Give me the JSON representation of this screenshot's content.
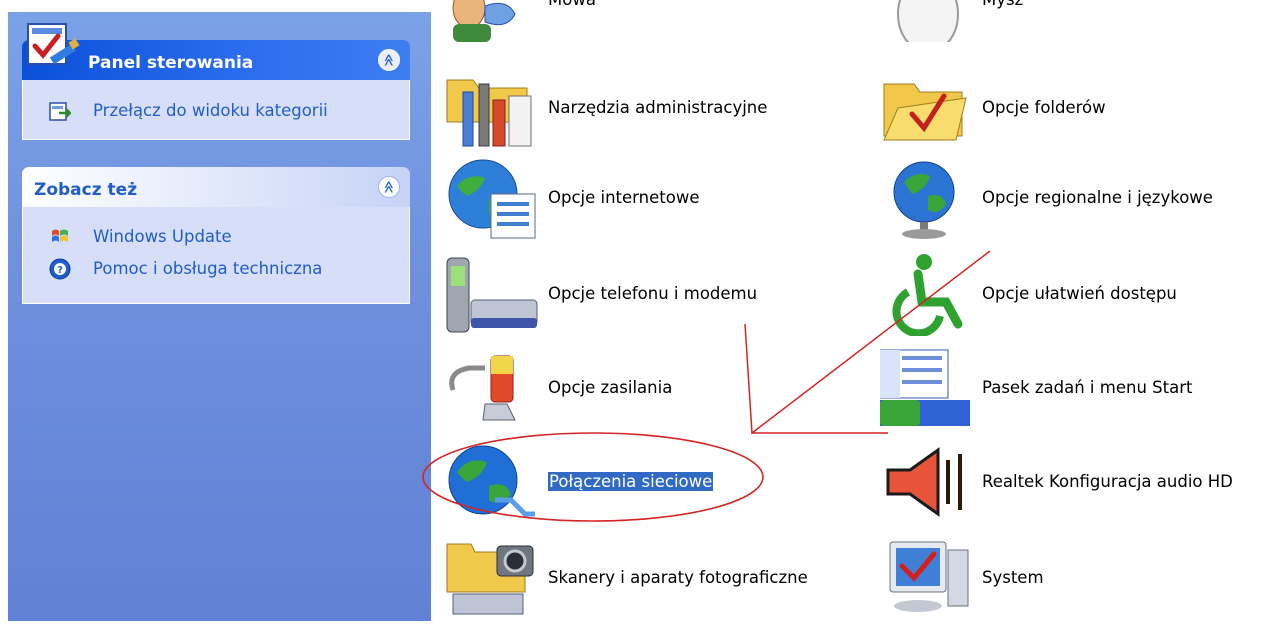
{
  "sidebar": {
    "control_panel": {
      "title": "Panel sterowania",
      "task": "Przełącz do widoku kategorii"
    },
    "see_also": {
      "title": "Zobacz też",
      "items": [
        {
          "label": "Windows Update",
          "icon": "windows-update-icon"
        },
        {
          "label": "Pomoc i obsługa techniczna",
          "icon": "help-icon"
        }
      ]
    },
    "collapse_glyph": "≪"
  },
  "items": {
    "mowa": "Mowa",
    "mysz": "Mysz",
    "narzedzia": "Narzędzia administracyjne",
    "opcje_folderow": "Opcje folderów",
    "opcje_internetowe": "Opcje internetowe",
    "opcje_regionalne": "Opcje regionalne i językowe",
    "opcje_telefonu": "Opcje telefonu i modemu",
    "opcje_ulatwien": "Opcje ułatwień dostępu",
    "opcje_zasilania": "Opcje zasilania",
    "pasek_zadan": "Pasek zadań i menu Start",
    "polaczenia": "Połączenia sieciowe",
    "realtek": "Realtek Konfiguracja audio HD",
    "skanery": "Skanery i aparaty fotograficzne",
    "system": "System"
  },
  "colors": {
    "selection": "#316ac5",
    "annotation": "#d42424",
    "sidebar_link": "#215dc6"
  }
}
